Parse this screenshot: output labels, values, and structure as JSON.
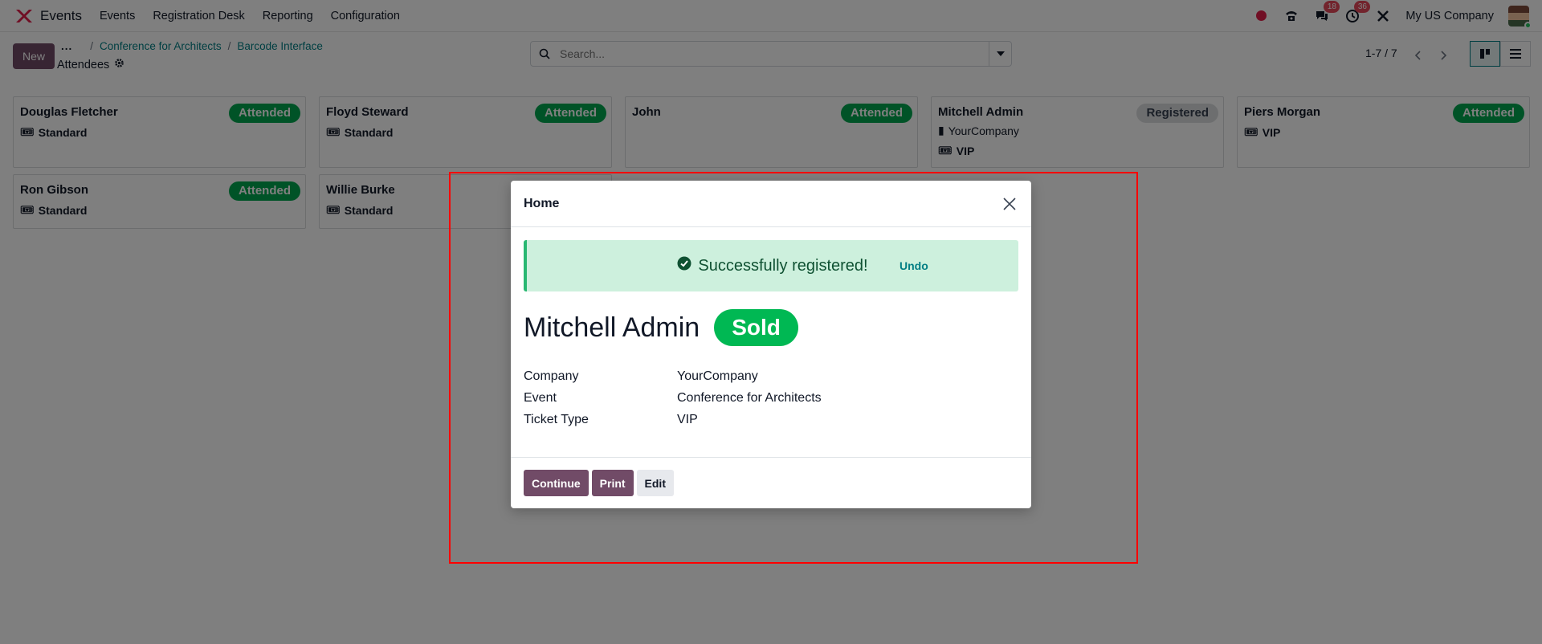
{
  "navbar": {
    "app_name": "Events",
    "menu": [
      "Events",
      "Registration Desk",
      "Reporting",
      "Configuration"
    ],
    "messages_badge": "18",
    "activities_badge": "36",
    "company": "My US Company",
    "colors": {
      "brand_red": "#e11d48",
      "badge": "#e5485b"
    }
  },
  "control_panel": {
    "new_label": "New",
    "breadcrumb_dots": "...",
    "breadcrumb": [
      "Conference for Architects",
      "Barcode Interface"
    ],
    "view_title": "Attendees",
    "search_placeholder": "Search...",
    "pager": "1-7 / 7"
  },
  "kanban": {
    "cards": [
      {
        "name": "Douglas Fletcher",
        "status": "Attended",
        "lines": [
          "Standard"
        ]
      },
      {
        "name": "Floyd Steward",
        "status": "Attended",
        "lines": [
          "Standard"
        ]
      },
      {
        "name": "John",
        "status": "Attended",
        "lines": []
      },
      {
        "name": "Mitchell Admin",
        "status": "Registered",
        "company": "YourCompany",
        "lines": [
          "VIP"
        ]
      },
      {
        "name": "Piers Morgan",
        "status": "Attended",
        "lines": [
          "VIP"
        ]
      },
      {
        "name": "Ron Gibson",
        "status": "Attended",
        "lines": [
          "Standard"
        ]
      },
      {
        "name": "Willie Burke",
        "status": "",
        "lines": [
          "Standard"
        ]
      }
    ]
  },
  "modal": {
    "title": "Home",
    "alert_message": "Successfully registered!",
    "undo_label": "Undo",
    "attendee_name": "Mitchell Admin",
    "attendee_status": "Sold",
    "details": [
      {
        "label": "Company",
        "value": "YourCompany"
      },
      {
        "label": "Event",
        "value": "Conference for Architects"
      },
      {
        "label": "Ticket Type",
        "value": "VIP"
      }
    ],
    "buttons": {
      "continue": "Continue",
      "print": "Print",
      "edit": "Edit"
    },
    "colors": {
      "success_bg": "#cdf0dd",
      "sold_badge": "#00b853",
      "primary": "#714b67"
    }
  }
}
